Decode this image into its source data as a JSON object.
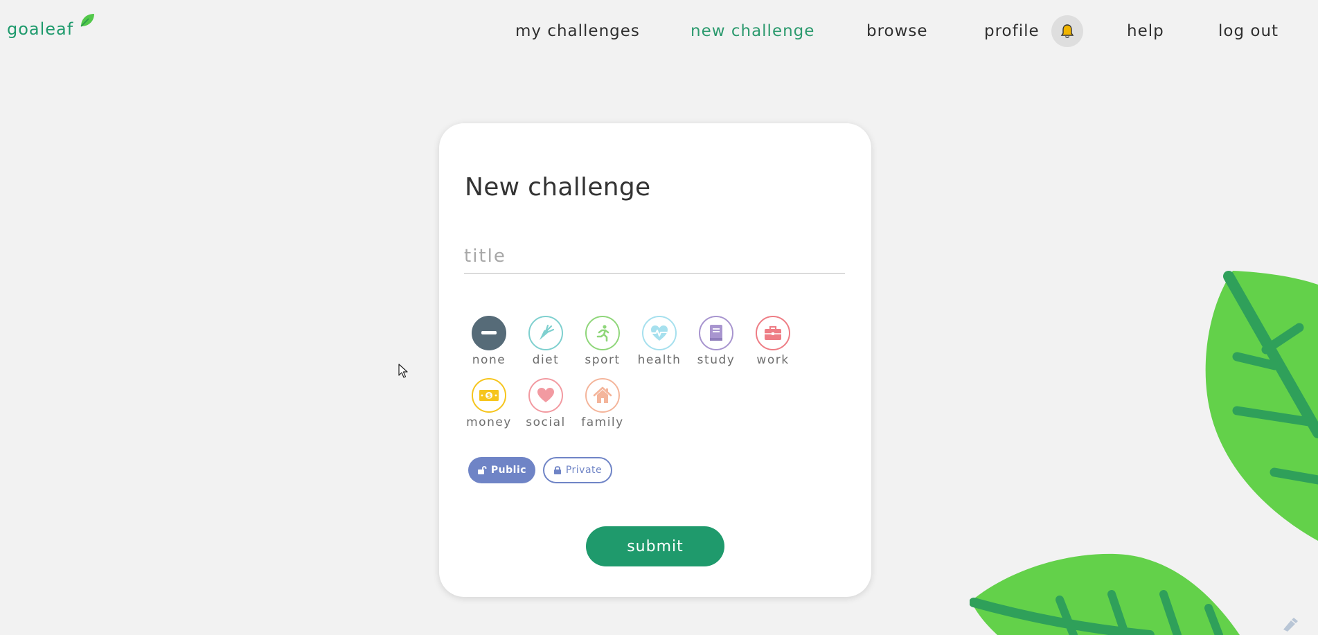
{
  "app": {
    "logo_text": "goaleaf"
  },
  "nav": {
    "items": [
      {
        "label": "my challenges",
        "active": false
      },
      {
        "label": "new challenge",
        "active": true
      },
      {
        "label": "browse",
        "active": false
      },
      {
        "label": "profile",
        "active": false
      },
      {
        "label": "help",
        "active": false
      },
      {
        "label": "log out",
        "active": false
      }
    ],
    "notifications_icon": "bell-icon"
  },
  "form": {
    "heading": "New challenge",
    "title_placeholder": "title",
    "title_value": "",
    "categories": [
      {
        "label": "none",
        "icon": "minus-icon",
        "color": "#566b78",
        "selected": true
      },
      {
        "label": "diet",
        "icon": "carrot-icon",
        "color": "#7fd0cf",
        "selected": false
      },
      {
        "label": "sport",
        "icon": "running-icon",
        "color": "#8fd67a",
        "selected": false
      },
      {
        "label": "health",
        "icon": "heartbeat-icon",
        "color": "#a6e0ee",
        "selected": false
      },
      {
        "label": "study",
        "icon": "book-icon",
        "color": "#a895cf",
        "selected": false
      },
      {
        "label": "work",
        "icon": "briefcase-icon",
        "color": "#ee7d85",
        "selected": false
      },
      {
        "label": "money",
        "icon": "money-icon",
        "color": "#f6c51d",
        "selected": false
      },
      {
        "label": "social",
        "icon": "heart-icon",
        "color": "#f29aa1",
        "selected": false
      },
      {
        "label": "family",
        "icon": "house-icon",
        "color": "#f4b59b",
        "selected": false
      }
    ],
    "visibility": {
      "public_label": "Public",
      "private_label": "Private",
      "selected": "Public"
    },
    "submit_label": "submit"
  },
  "colors": {
    "brand": "#1f9a6c",
    "accent_blue": "#6f84c6",
    "leaf_green": "#63d14a",
    "leaf_vein": "#2fa05a"
  }
}
